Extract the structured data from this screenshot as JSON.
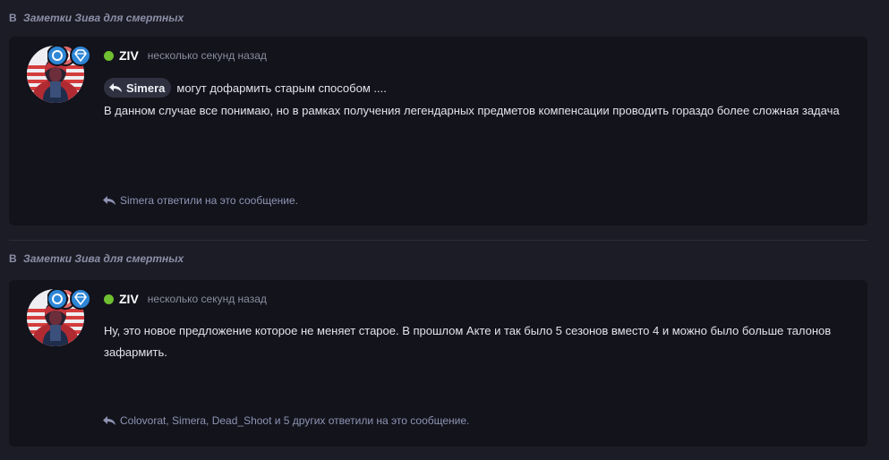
{
  "posts": [
    {
      "breadcrumb": {
        "prefix": "В",
        "topic": "Заметки Зива для смертных"
      },
      "author": "ZIV",
      "time": "несколько секунд назад",
      "quote": {
        "mention": "Simera",
        "text": "могут дофармить старым способом ...."
      },
      "body": "В данном случае все понимаю, но в рамках получения легендарных предметов компенсации проводить гораздо более сложная задача",
      "replies": "Simera ответили на это сообщение."
    },
    {
      "breadcrumb": {
        "prefix": "В",
        "topic": "Заметки Зива для смертных"
      },
      "author": "ZIV",
      "time": "несколько секунд назад",
      "body": "Ну, это новое предложение которое не меняет старое. В прошлом Акте и так было 5 сезонов вместо 4 и можно было больше талонов зафармить.",
      "replies": "Colovorat, Simera, Dead_Shoot и 5 других ответили на это сообщение."
    }
  ],
  "colors": {
    "background": "#1c1c26",
    "card": "#12131b",
    "online": "#6fbf30",
    "muted": "#8f94b4",
    "badge_blue": "#2e86d6",
    "badge_red": "#e06a6a"
  },
  "icons": {
    "reply": "reply-arrow-icon",
    "online": "online-dot",
    "badges": [
      "red-badge-icon",
      "blue-badge-icon",
      "diamond-badge-icon"
    ]
  }
}
